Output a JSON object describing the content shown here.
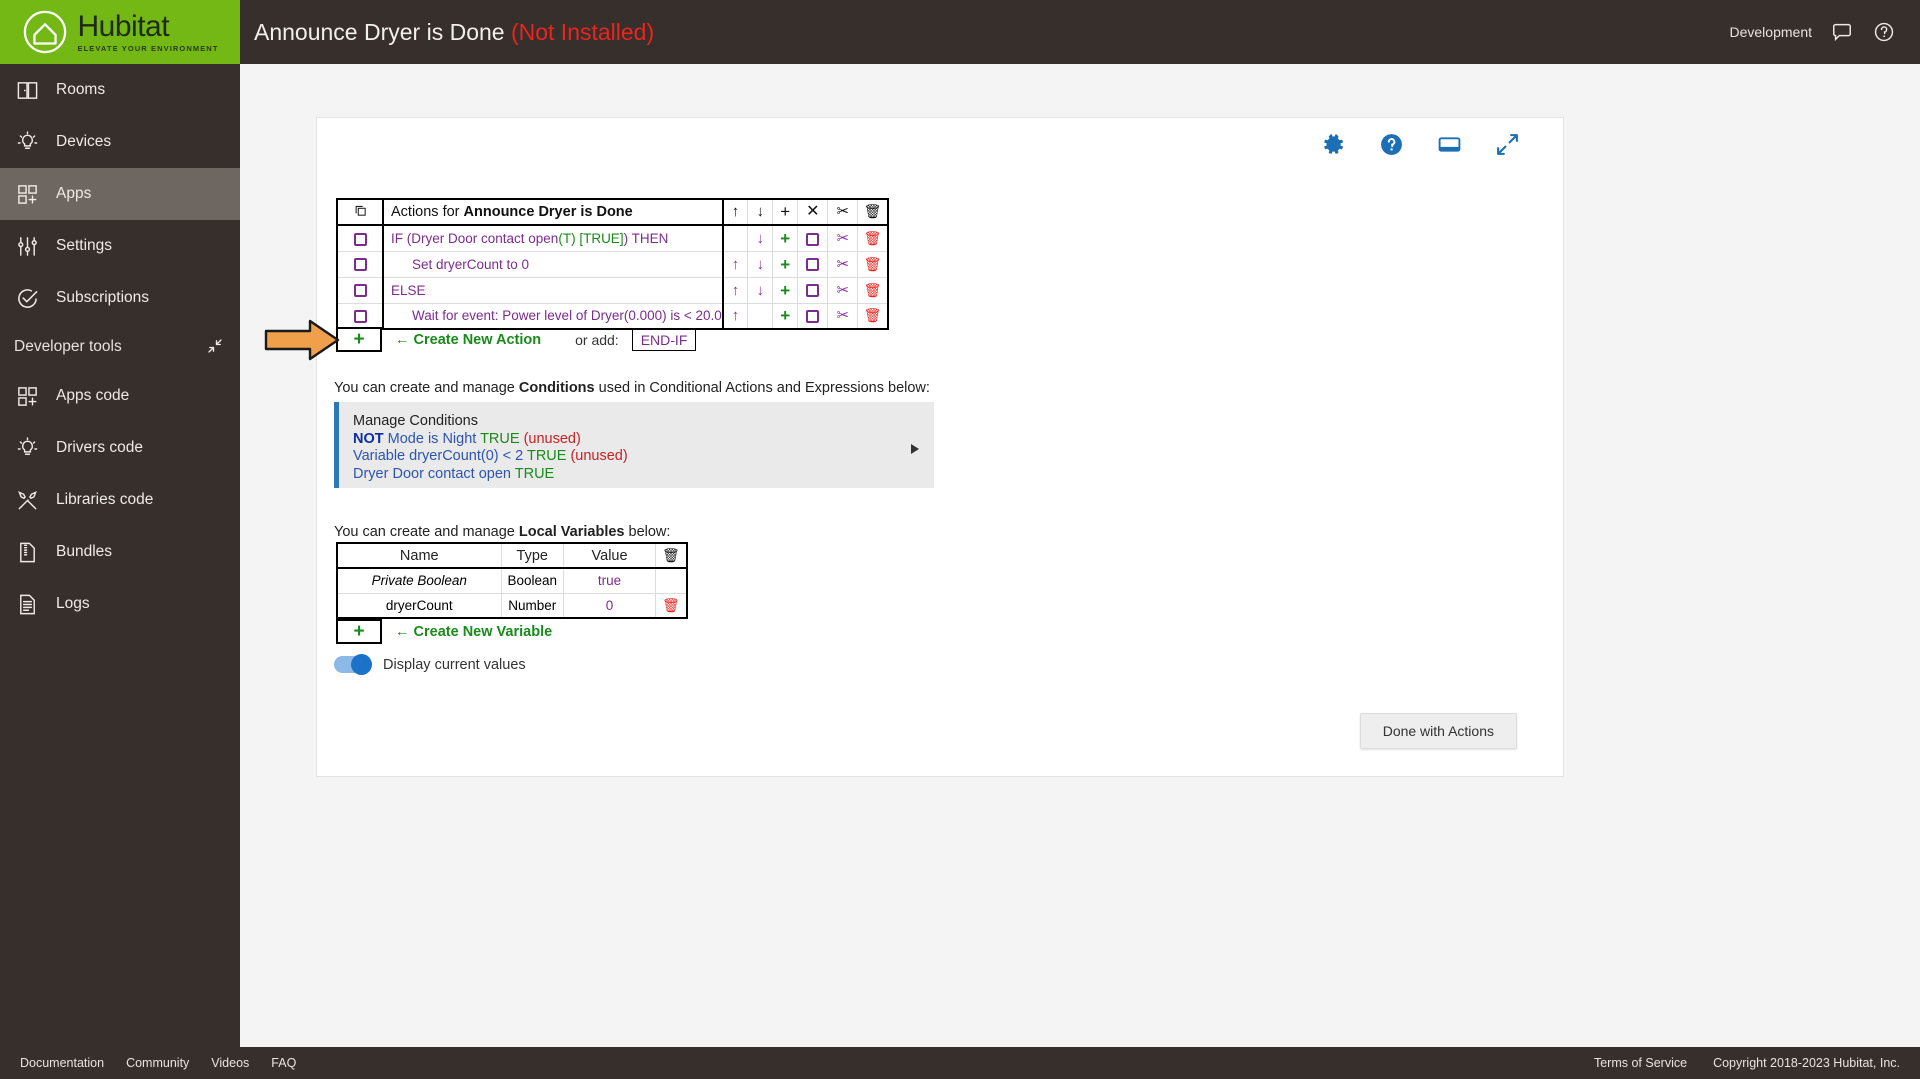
{
  "header": {
    "logo_word": "Hubitat",
    "logo_tagline": "ELEVATE YOUR ENVIRONMENT",
    "title": "Announce Dryer is Done",
    "title_status": "(Not Installed)",
    "environment": "Development",
    "chat_icon": "chat-bubble-icon",
    "help_icon": "help-circle-icon",
    "accent_green": "#74b816",
    "bar_color": "#362f2b",
    "status_color": "#e8251f"
  },
  "sidebar": {
    "items": [
      {
        "label": "Rooms",
        "icon": "rooms-icon",
        "active": false
      },
      {
        "label": "Devices",
        "icon": "device-bulb-icon",
        "active": false
      },
      {
        "label": "Apps",
        "icon": "apps-grid-icon",
        "active": true
      },
      {
        "label": "Settings",
        "icon": "sliders-icon",
        "active": false
      },
      {
        "label": "Subscriptions",
        "icon": "check-circle-icon",
        "active": false
      }
    ],
    "section_label": "Developer tools",
    "section_collapse_icon": "collapse-icon",
    "dev_items": [
      {
        "label": "Apps code",
        "icon": "apps-grid-icon"
      },
      {
        "label": "Drivers code",
        "icon": "device-bulb-icon"
      },
      {
        "label": "Libraries code",
        "icon": "tools-icon"
      },
      {
        "label": "Bundles",
        "icon": "bundle-zip-icon"
      },
      {
        "label": "Logs",
        "icon": "document-lines-icon"
      }
    ]
  },
  "card_tools": [
    {
      "name": "gear-icon",
      "label": "Settings"
    },
    {
      "name": "help-circle-icon",
      "label": "Help"
    },
    {
      "name": "monitor-icon",
      "label": "Display"
    },
    {
      "name": "expand-icon",
      "label": "Expand"
    }
  ],
  "actions": {
    "header": {
      "copy_icon": "copy-icon",
      "title_prefix": "Actions for ",
      "title_name": "Announce Dryer is Done",
      "up_icon": "arrow-up-icon",
      "down_icon": "arrow-down-icon",
      "plus_icon": "plus-icon",
      "close_icon": "close-x-icon",
      "cut_icon": "scissors-icon",
      "trash_icon": "trash-icon"
    },
    "rows": [
      {
        "text": "IF (Dryer Door contact open(T) [TRUE]) THEN",
        "segments": [
          {
            "t": "IF (Dryer Door contact open",
            "c": "purple"
          },
          {
            "t": "(T) [TRUE]",
            "c": "green"
          },
          {
            "t": ") THEN",
            "c": "purple"
          }
        ],
        "indent": 0,
        "up": false,
        "down": true
      },
      {
        "text": "Set dryerCount to 0",
        "segments": [
          {
            "t": "Set dryerCount to 0",
            "c": "purple"
          }
        ],
        "indent": 1,
        "up": true,
        "down": true
      },
      {
        "text": "ELSE",
        "segments": [
          {
            "t": "ELSE",
            "c": "purple"
          }
        ],
        "indent": 0,
        "up": true,
        "down": true
      },
      {
        "text": "Wait for event: Power level of Dryer(0.000) is < 20.0",
        "segments": [
          {
            "t": "Wait for event: Power level of Dryer(0.000) is < 20.0",
            "c": "purple"
          }
        ],
        "indent": 1,
        "up": true,
        "down": false
      }
    ],
    "create_plus": "+",
    "create_label": "← Create New Action",
    "or_add_label": "or add:",
    "endif_label": "END-IF",
    "pointer_icon": "orange-arrow-pointer"
  },
  "conditions_intro": {
    "prefix": "You can create and manage ",
    "bold": "Conditions",
    "suffix": " used in Conditional Actions and Expressions below:"
  },
  "conditions": {
    "title": "Manage Conditions",
    "caret_icon": "caret-right-icon",
    "lines": [
      [
        {
          "t": "NOT ",
          "c": "navy"
        },
        {
          "t": "Mode is Night ",
          "c": "blue"
        },
        {
          "t": "TRUE ",
          "c": "green"
        },
        {
          "t": "(unused)",
          "c": "red"
        }
      ],
      [
        {
          "t": "Variable dryerCount(0) < 2 ",
          "c": "blue"
        },
        {
          "t": "TRUE ",
          "c": "green"
        },
        {
          "t": "(unused)",
          "c": "red"
        }
      ],
      [
        {
          "t": "Dryer Door contact open ",
          "c": "blue"
        },
        {
          "t": "TRUE",
          "c": "green"
        }
      ]
    ]
  },
  "variables_intro": {
    "prefix": "You can create and manage ",
    "bold": "Local Variables",
    "suffix": " below:"
  },
  "variables": {
    "columns": [
      "Name",
      "Type",
      "Value"
    ],
    "trash_icon": "trash-icon",
    "rows": [
      {
        "name": "Private Boolean",
        "type": "Boolean",
        "value": "true",
        "italic": true,
        "deletable": false
      },
      {
        "name": "dryerCount",
        "type": "Number",
        "value": "0",
        "italic": false,
        "deletable": true
      }
    ],
    "create_plus": "+",
    "create_label": "← Create New Variable"
  },
  "display_toggle": {
    "label": "Display current values",
    "on": true,
    "color": "#1a73c8"
  },
  "done_button": "Done with Actions",
  "footer": {
    "links": [
      "Documentation",
      "Community",
      "Videos",
      "FAQ"
    ],
    "terms": "Terms of Service",
    "copyright": "Copyright 2018-2023 Hubitat, Inc."
  }
}
